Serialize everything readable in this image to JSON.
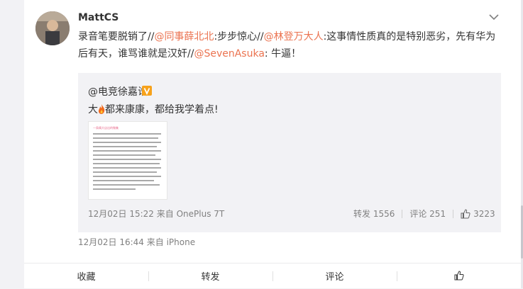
{
  "post": {
    "username": "MattCS",
    "text_segments": [
      {
        "text": "录音笔要脱销了//",
        "mention": false
      },
      {
        "text": "@同事薛北北",
        "mention": true
      },
      {
        "text": ":步步惊心//",
        "mention": false
      },
      {
        "text": "@林登万大人",
        "mention": true
      },
      {
        "text": ":这事情性质真的是特别恶劣，先有华为后有天，谁骂谁就是汉奸//",
        "mention": false
      },
      {
        "text": "@SevenAsuka",
        "mention": true
      },
      {
        "text": ": 牛逼！",
        "mention": false
      }
    ],
    "timestamp": "12月02日 16:44",
    "source": "来自 iPhone"
  },
  "repost": {
    "author": "@电竞徐嘉诰",
    "badge_icon": "verified-v-icon",
    "text_before": "大",
    "emoji_icon": "fire-icon",
    "text_after": "都来康康，都给我学着点!",
    "image_title": "一条精大店出的微集",
    "timestamp": "12月02日 15:22",
    "source": "来自 OnePlus 7T",
    "reposts_label": "转发 1556",
    "comments_label": "评论 251",
    "likes": "3223"
  },
  "actions": {
    "favorite": "收藏",
    "repost": "转发",
    "comment": "评论"
  },
  "colors": {
    "mention": "#eb7350",
    "meta": "#808080",
    "repost_bg": "#f2f2f5",
    "badge": "#f7a21b"
  }
}
